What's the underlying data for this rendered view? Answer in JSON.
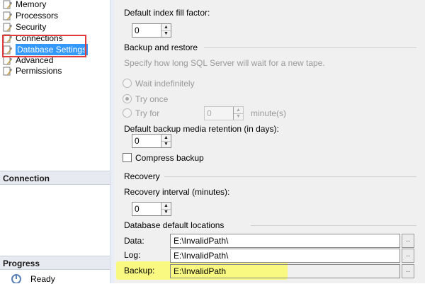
{
  "nav": {
    "items": [
      {
        "label": "Memory",
        "icon": "wrench-page-icon"
      },
      {
        "label": "Processors",
        "icon": "wrench-page-icon"
      },
      {
        "label": "Security",
        "icon": "wrench-page-icon"
      },
      {
        "label": "Connections",
        "icon": "wrench-page-icon"
      },
      {
        "label": "Database Settings",
        "icon": "wrench-page-icon",
        "selected": true
      },
      {
        "label": "Advanced",
        "icon": "wrench-page-icon"
      },
      {
        "label": "Permissions",
        "icon": "wrench-page-icon"
      }
    ],
    "connection_header": "Connection",
    "progress_header": "Progress",
    "progress_status": "Ready"
  },
  "settings": {
    "fill_factor_label": "Default index fill factor:",
    "fill_factor_value": "0",
    "backup_restore_header": "Backup and restore",
    "backup_restore_desc": "Specify how long SQL Server will wait for a new tape.",
    "wait_indefinitely": "Wait indefinitely",
    "try_once": "Try once",
    "try_for": "Try for",
    "try_for_value": "0",
    "try_for_unit": "minute(s)",
    "retention_label": "Default backup media retention (in days):",
    "retention_value": "0",
    "compress_backup": "Compress backup",
    "recovery_header": "Recovery",
    "recovery_interval_label": "Recovery interval (minutes):",
    "recovery_interval_value": "0",
    "locations_header": "Database default locations",
    "data_label": "Data:",
    "data_path": "E:\\InvalidPath\\",
    "log_label": "Log:",
    "log_path": "E:\\InvalidPath\\",
    "backup_label": "Backup:",
    "backup_path": "E:\\InvalidPath",
    "browse": ".."
  },
  "colors": {
    "selection": "#3399ff",
    "annotation_red": "#e03a3a",
    "annotation_yellow": "#fafa6e"
  }
}
